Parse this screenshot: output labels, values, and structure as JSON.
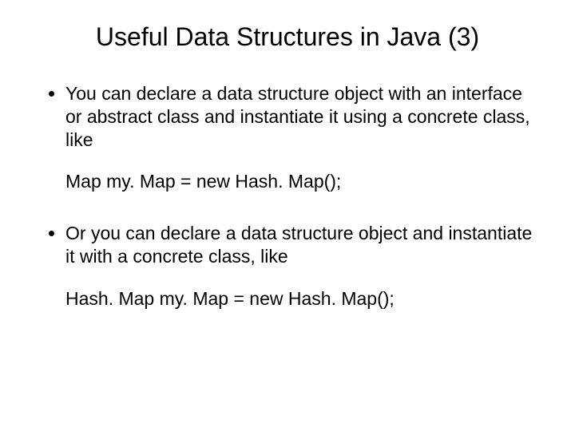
{
  "title": "Useful Data Structures in Java (3)",
  "bullets": {
    "b1": "You can declare a data structure object with an interface or abstract class and instantiate it using a concrete class, like",
    "code1": "Map my. Map = new Hash. Map();",
    "b2": "Or you can declare a data structure object and instantiate it with a concrete class, like",
    "code2": "Hash. Map my. Map = new Hash. Map();"
  }
}
